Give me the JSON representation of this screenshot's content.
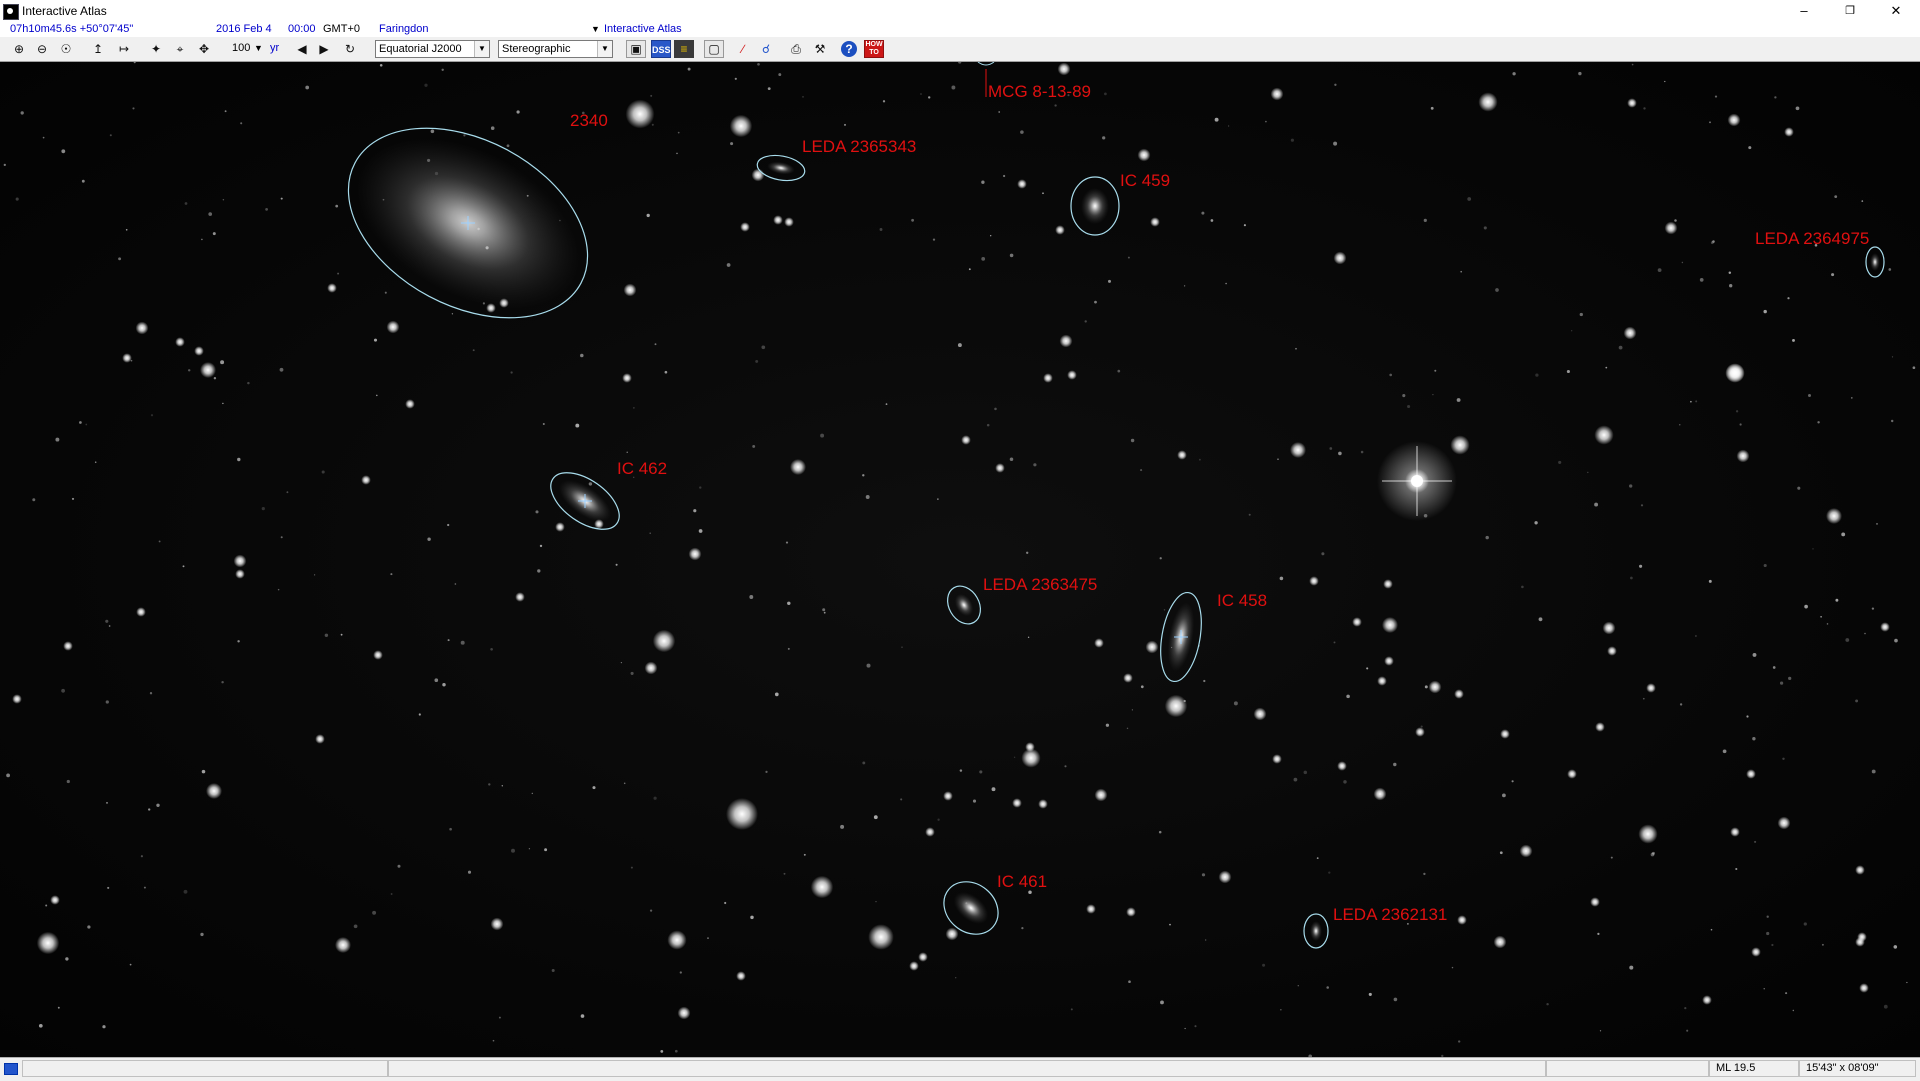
{
  "window": {
    "title": "Interactive Atlas",
    "minimize": "–",
    "restore": "❐",
    "close": "✕"
  },
  "info": {
    "coords": "07h10m45.6s +50°07'45\"",
    "date": "2016 Feb 4",
    "time": "00:00",
    "timezone": "GMT+0",
    "location": "Faringdon",
    "mode": "Interactive Atlas"
  },
  "toolbar": {
    "step_value": "100",
    "step_unit": "yr",
    "coord_system": "Equatorial J2000",
    "projection": "Stereographic",
    "icons": [
      "zoom-in-icon",
      "zoom-out-icon",
      "zoom-fit-icon",
      "flip-vertical-icon",
      "flip-horizontal-icon",
      "center-star-icon",
      "reticle-icon",
      "expand-icon",
      "arrow-left-icon",
      "arrow-right-icon",
      "refresh-icon",
      "monitor-icon",
      "dss-image-icon",
      "chart-icon",
      "frame-icon",
      "measure-icon",
      "link-icon",
      "print-icon",
      "tools-icon",
      "help-icon",
      "howto-icon"
    ]
  },
  "objects": [
    {
      "name": "2340"
    },
    {
      "name": "LEDA 2365343"
    },
    {
      "name": "MCG 8-13-89"
    },
    {
      "name": "IC 459"
    },
    {
      "name": "LEDA 2364975"
    },
    {
      "name": "IC 462"
    },
    {
      "name": "LEDA 2363475"
    },
    {
      "name": "IC 458"
    },
    {
      "name": "IC 461"
    },
    {
      "name": "LEDA 2362131"
    }
  ],
  "status": {
    "magnitude_limit": "ML 19.5",
    "field_size": "15'43\" x 08'09\""
  },
  "colors": {
    "label": "#e01010",
    "outline": "#a8dcec",
    "link_text": "#0000cc"
  }
}
